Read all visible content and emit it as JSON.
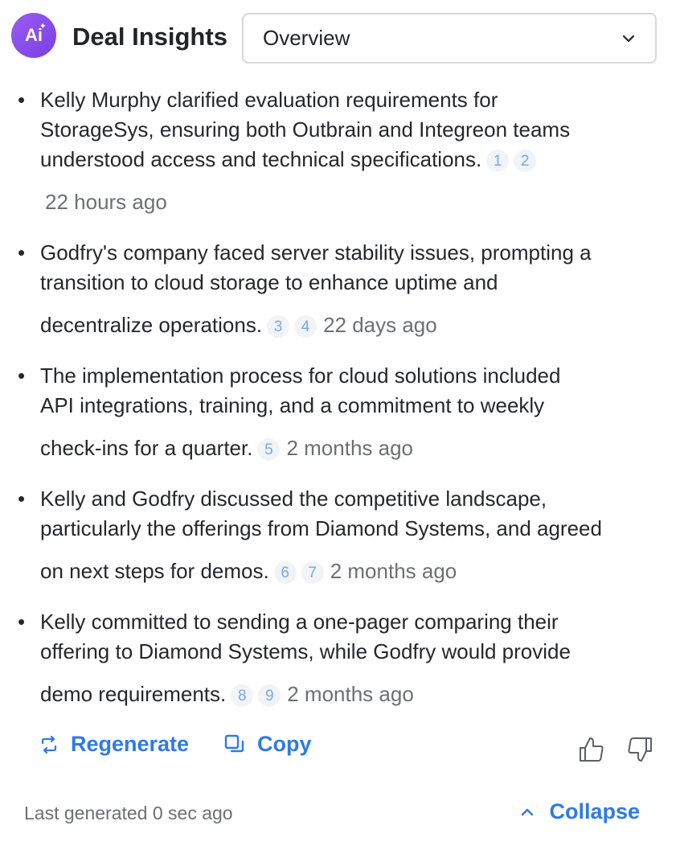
{
  "header": {
    "badge_label": "Ai",
    "title": "Deal Insights",
    "view_select": {
      "selected": "Overview"
    }
  },
  "insights": [
    {
      "lines": [
        "Kelly Murphy clarified evaluation requirements for",
        "StorageSys, ensuring both Outbrain and Integreon teams",
        "understood access and technical specifications."
      ],
      "refs": [
        "1",
        "2"
      ],
      "time": "22 hours ago"
    },
    {
      "lines": [
        "Godfry's company faced server stability issues, prompting a",
        "transition to cloud storage to enhance uptime and",
        "decentralize operations."
      ],
      "refs": [
        "3",
        "4"
      ],
      "time": "22 days ago"
    },
    {
      "lines": [
        "The implementation process for cloud solutions included",
        "API integrations, training, and a commitment to weekly",
        "check-ins for a quarter."
      ],
      "refs": [
        "5"
      ],
      "time": "2 months ago"
    },
    {
      "lines": [
        "Kelly and Godfry discussed the competitive landscape,",
        "particularly the offerings from Diamond Systems, and agreed",
        "on next steps for demos."
      ],
      "refs": [
        "6",
        "7"
      ],
      "time": "2 months ago"
    },
    {
      "lines": [
        "Kelly committed to sending a one-pager comparing their",
        "offering to Diamond Systems, while Godfry would provide",
        "demo requirements."
      ],
      "refs": [
        "8",
        "9"
      ],
      "time": "2 months ago"
    }
  ],
  "actions": {
    "regenerate_label": "Regenerate",
    "copy_label": "Copy"
  },
  "footer": {
    "last_generated": "Last generated 0 sec ago",
    "collapse_label": "Collapse"
  },
  "colors": {
    "accent": "#2f7ae5",
    "badge": "#8a4cec",
    "ref_text": "#7aa7e8",
    "muted_text": "#6c6f74"
  }
}
